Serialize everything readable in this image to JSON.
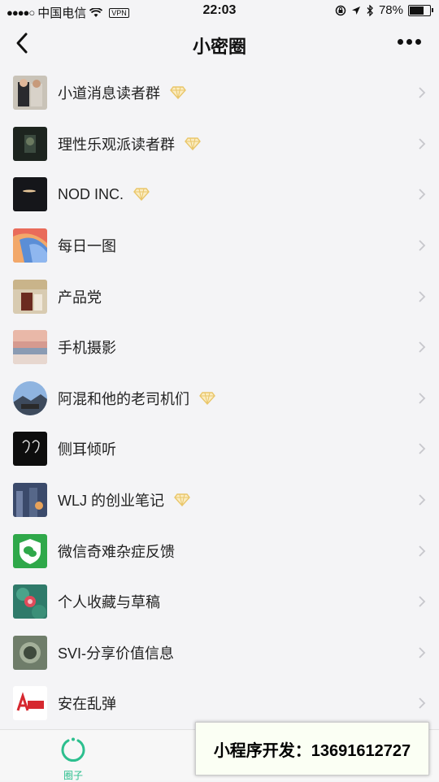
{
  "status_bar": {
    "carrier": "中国电信",
    "vpn": "VPN",
    "time": "22:03",
    "battery": "78%",
    "battery_level": 0.78
  },
  "nav": {
    "title": "小密圈"
  },
  "groups": [
    {
      "name": "小道消息读者群",
      "premium": true
    },
    {
      "name": "理性乐观派读者群",
      "premium": true
    },
    {
      "name": "NOD INC.",
      "premium": true
    },
    {
      "name": "每日一图",
      "premium": false
    },
    {
      "name": "产品党",
      "premium": false
    },
    {
      "name": "手机摄影",
      "premium": false
    },
    {
      "name": "阿混和他的老司机们",
      "premium": true
    },
    {
      "name": "侧耳倾听",
      "premium": false
    },
    {
      "name": "WLJ 的创业笔记",
      "premium": true
    },
    {
      "name": "微信奇难杂症反馈",
      "premium": false
    },
    {
      "name": "个人收藏与草稿",
      "premium": false
    },
    {
      "name": "SVI-分享价值信息",
      "premium": false
    },
    {
      "name": "安在乱弹",
      "premium": false
    }
  ],
  "tabs": {
    "circle_label": "圈子"
  },
  "promo": {
    "text": "小程序开发：13691612727"
  },
  "colors": {
    "accent": "#2cbf8e",
    "diamond": "#e9c66a",
    "background": "#f4f4f6"
  }
}
